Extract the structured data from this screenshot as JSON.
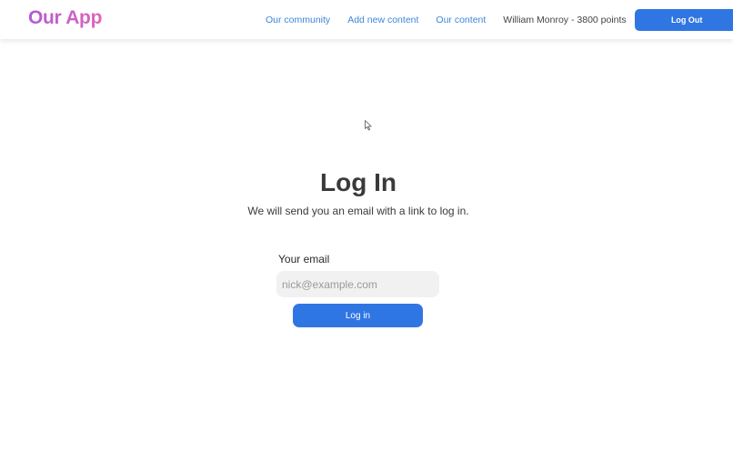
{
  "app": {
    "logo_text": "Our App"
  },
  "nav": {
    "links": [
      {
        "label": "Our community"
      },
      {
        "label": "Add new content"
      },
      {
        "label": "Our content"
      }
    ],
    "user_info": "William Monroy - 3800 points",
    "logout_label": "Log Out"
  },
  "login": {
    "title": "Log In",
    "subtitle": "We will send you an email with a link to log in.",
    "email_label": "Your email",
    "email_placeholder": "nick@example.com",
    "email_value": "",
    "submit_label": "Log in"
  },
  "colors": {
    "accent": "#2f76e3",
    "link": "#3f86d9",
    "logo_gradient_start": "#b05cd6",
    "logo_gradient_end": "#e064b8"
  },
  "icons": {
    "cursor": "mouse-pointer-icon"
  }
}
